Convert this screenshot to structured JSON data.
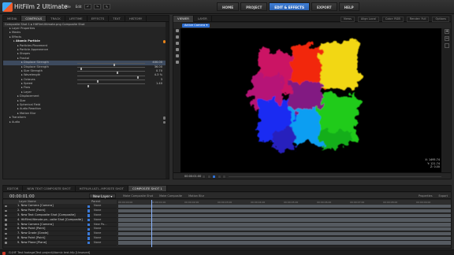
{
  "app": {
    "brand": "HitFilm 2 Ultimate",
    "menus": [
      "File",
      "Edit"
    ]
  },
  "nav": {
    "buttons": [
      "HOME",
      "PROJECT",
      "EDIT & EFFECTS",
      "EXPORT",
      "HELP"
    ],
    "active": "EDIT & EFFECTS"
  },
  "left_panel": {
    "tabs": [
      "MEDIA",
      "CONTROLS",
      "TRACK",
      "LIFETIME",
      "EFFECTS",
      "TEXT",
      "HISTORY"
    ],
    "active_tab": "CONTROLS",
    "breadcrumb": "Composite Shot 1",
    "breadcrumb_layer": "HitFilmUltimate.png Composite Shot",
    "properties": [
      {
        "label": "Layer Properties",
        "indent": 1
      },
      {
        "label": "Masks",
        "indent": 1
      },
      {
        "label": "Effects",
        "indent": 1
      },
      {
        "label": "Atomic Particle",
        "indent": 2,
        "bold": true,
        "orange": true
      },
      {
        "label": "Particles Placement",
        "indent": 3
      },
      {
        "label": "Particle Appearance",
        "indent": 3
      },
      {
        "label": "Shapes",
        "indent": 3
      },
      {
        "label": "Fractal",
        "indent": 3
      },
      {
        "label": "Displace Strength",
        "indent": 4,
        "value": "400.00",
        "selected": true,
        "slider": 0.55
      },
      {
        "label": "Displace Strength",
        "indent": 4,
        "value": "36.00",
        "slider": 0.05
      },
      {
        "label": "Size Strength",
        "indent": 4,
        "value": "0.70",
        "slider": 0.6
      },
      {
        "label": "Wavelength",
        "indent": 4,
        "value": "4.3 %",
        "slider": 0.9
      },
      {
        "label": "Octaves",
        "indent": 4,
        "value": "3",
        "slider": 0.3
      },
      {
        "label": "Speed",
        "indent": 4,
        "value": "1.40",
        "slider": 0.15
      },
      {
        "label": "Flow",
        "indent": 4
      },
      {
        "label": "Layer",
        "indent": 4
      },
      {
        "label": "Displacement",
        "indent": 3
      },
      {
        "label": "Size",
        "indent": 3
      },
      {
        "label": "Spherical Field",
        "indent": 3
      },
      {
        "label": "Audio Reaction",
        "indent": 3
      },
      {
        "label": "Motion Blur",
        "indent": 3
      },
      {
        "label": "Transform",
        "indent": 1,
        "gear": true
      },
      {
        "label": "Audio",
        "indent": 1,
        "gear": true
      }
    ]
  },
  "viewer": {
    "tabs": [
      "VIEWER",
      "LAYER"
    ],
    "active_tab": "VIEWER",
    "options": [
      "Views",
      "Align Local",
      "Color: RGB",
      "Render: Full",
      "Options"
    ],
    "camera": "Active Camera",
    "readout": [
      "X: 1495.74",
      "Y: 121.74",
      "Z: 0.00"
    ],
    "timecode": "00:00:01:00",
    "zoom_label": "+"
  },
  "timeline": {
    "tabs": [
      "EDITOR",
      "NEW TEXT COMPOSITE SHOT",
      "HITFILM-ULTI...MPOSITE SHOT",
      "COMPOSITE SHOT 1"
    ],
    "active_tab": "COMPOSITE SHOT 1",
    "timecode": "00:00:01:00",
    "new_layer": "New Layer",
    "mid_items": [
      "Make Composite Shot",
      "Make Composite",
      "Motion Blur"
    ],
    "right_items": [
      "Properties",
      "Export"
    ],
    "head_label": "Layer Name",
    "head_parent": "Parent",
    "layers": [
      {
        "name": "1. New Camera [Camera]",
        "parent": "None"
      },
      {
        "name": "2. New Point [Point]",
        "parent": "None"
      },
      {
        "name": "3. New Text Composite Shot [Composite]",
        "parent": "None"
      },
      {
        "name": "4. HitFilmUltimate.pn...osite Shot [Composite]",
        "parent": "None"
      },
      {
        "name": "5. New Camera [Camera]",
        "parent": "New Po..."
      },
      {
        "name": "6. New Point [Point]",
        "parent": "None"
      },
      {
        "name": "7. New Grade [Grade]",
        "parent": "None"
      },
      {
        "name": "8. New Point [Point]",
        "parent": "None"
      },
      {
        "name": "9. New Plane [Plane]",
        "parent": "None"
      }
    ],
    "ruler": [
      "00:00:00:00",
      "00:00:01:00",
      "00:00:02:00",
      "00:00:03:00",
      "00:00:04:00",
      "00:00:05:00",
      "00:00:06:00",
      "00:00:07:00",
      "00:00:08:00",
      "00:00:09:00"
    ]
  },
  "status": {
    "text": "G:\\HF Test footage\\Test project\\Atomic test.hfp [Unsaved]"
  },
  "colors": {
    "accent": "#2f6fd1",
    "panel": "#242424",
    "orange": "#e8841a"
  }
}
